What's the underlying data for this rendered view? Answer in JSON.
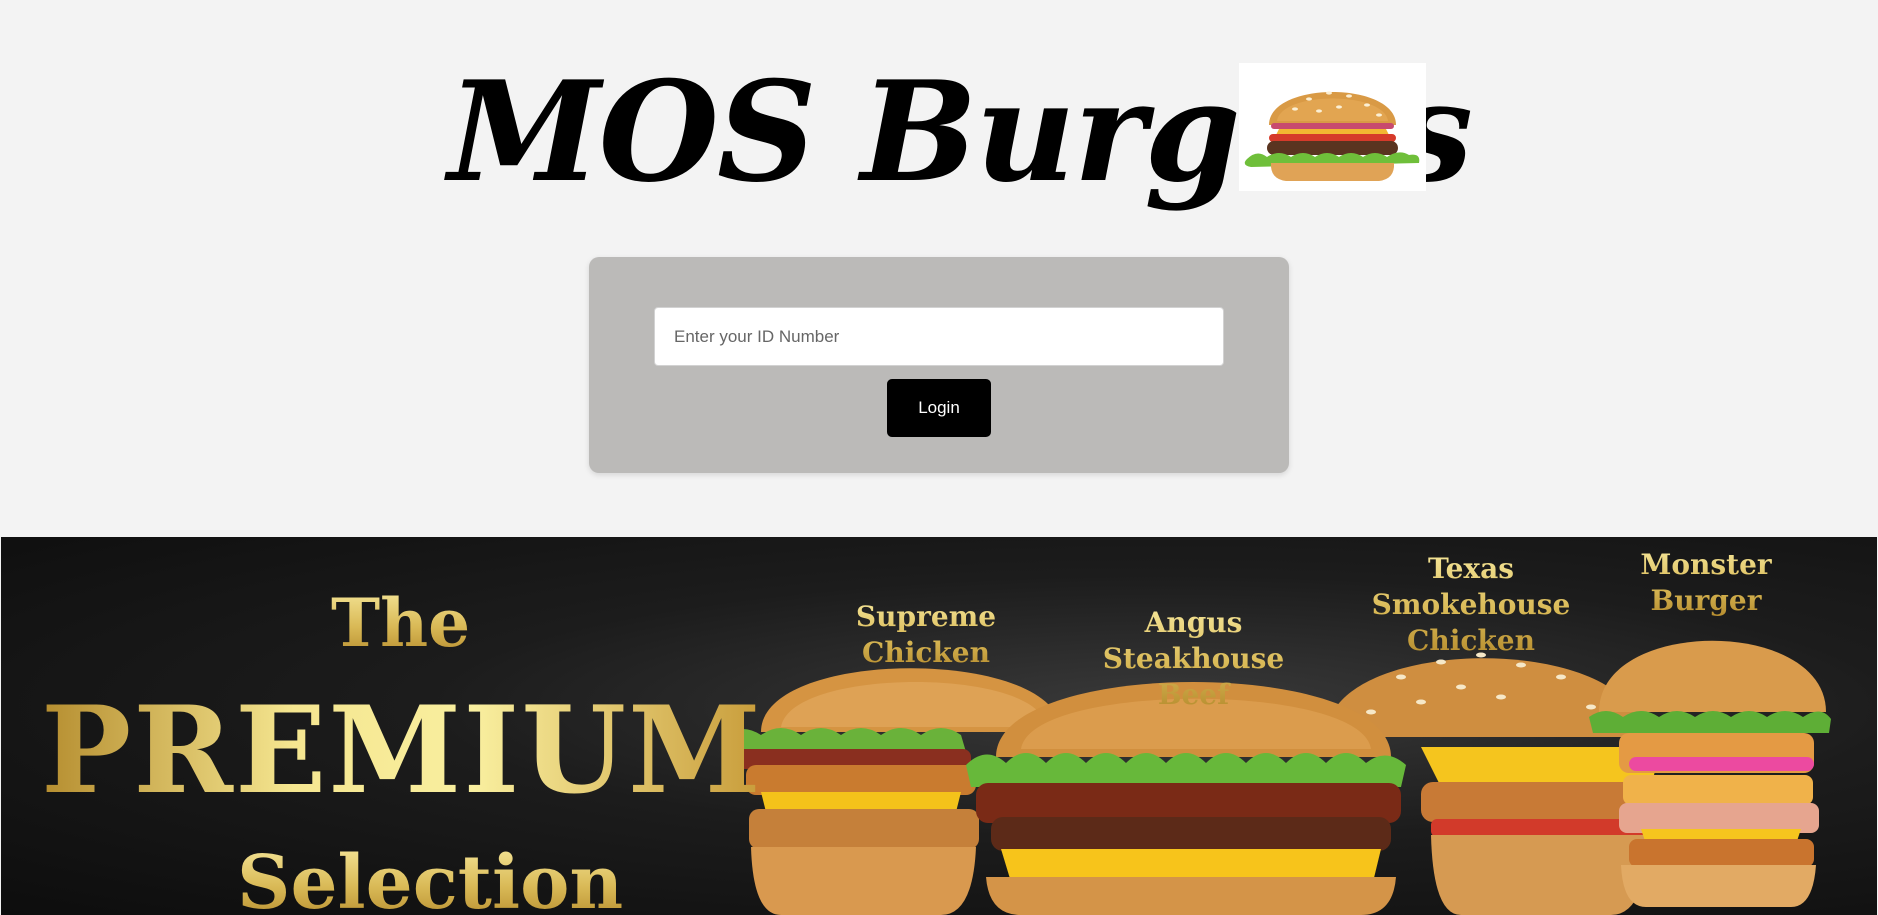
{
  "header": {
    "title": "MOS Burgers",
    "logo_icon": "burger-photo"
  },
  "login": {
    "id_placeholder": "Enter your ID Number",
    "id_value": "",
    "button_label": "Login"
  },
  "banner": {
    "line_1": "The",
    "line_2": "PREMIUM",
    "line_3": "Selection",
    "burgers": [
      {
        "label_line_1": "Supreme",
        "label_line_2": "Chicken"
      },
      {
        "label_line_1": "Angus Steakhouse",
        "label_line_2": "Beef"
      },
      {
        "label_line_1": "Texas",
        "label_line_2": "Smokehouse",
        "label_line_3": "Chicken"
      },
      {
        "label_line_1": "Monster",
        "label_line_2": "Burger"
      }
    ]
  },
  "colors": {
    "background": "#f3f3f3",
    "card": "#bbbab8",
    "button": "#000000",
    "gold": "#e6cc6e"
  }
}
